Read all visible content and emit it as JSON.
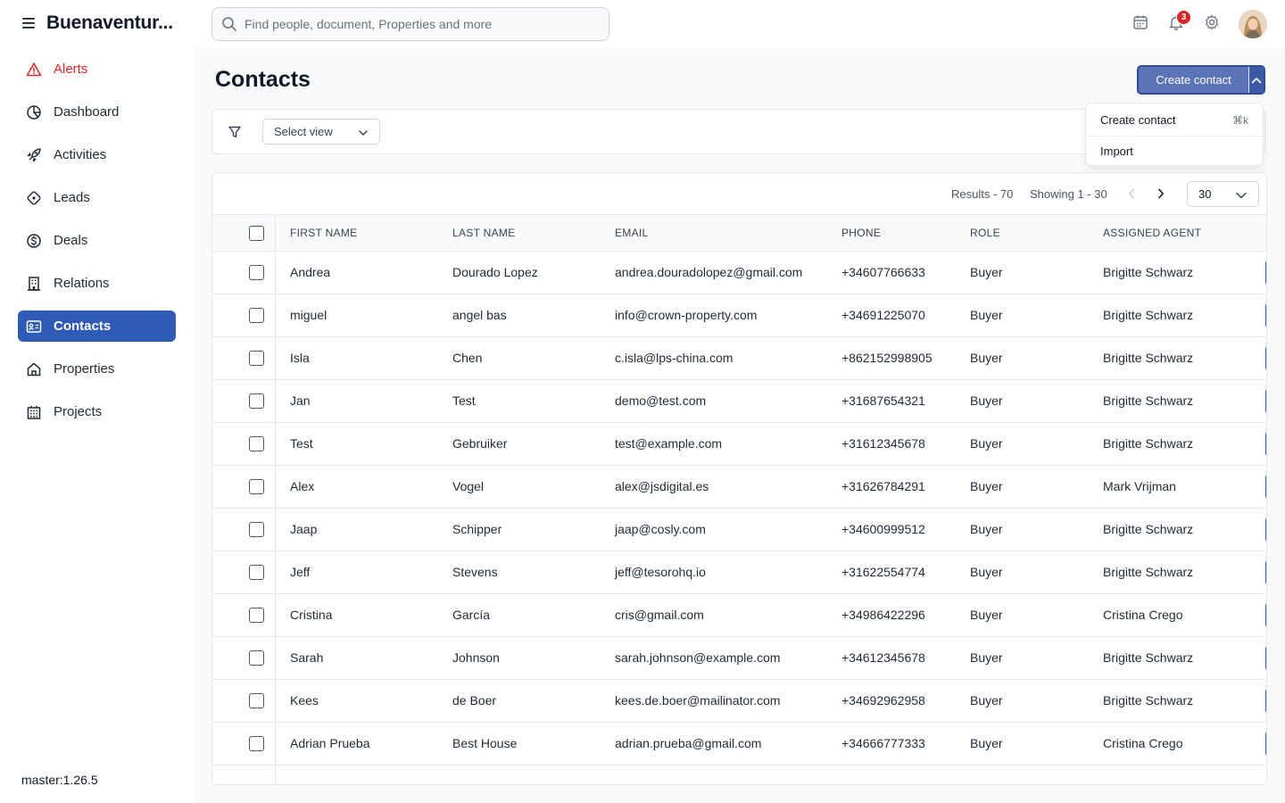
{
  "app": {
    "brand": "Buenaventur..."
  },
  "search": {
    "placeholder": "Find people, document, Properties and more"
  },
  "header": {
    "notification_count": "3"
  },
  "sidebar": {
    "items": [
      {
        "label": "Alerts",
        "icon": "alert-triangle-icon"
      },
      {
        "label": "Dashboard",
        "icon": "pie-chart-icon"
      },
      {
        "label": "Activities",
        "icon": "rocket-icon"
      },
      {
        "label": "Leads",
        "icon": "target-icon"
      },
      {
        "label": "Deals",
        "icon": "dollar-circle-icon"
      },
      {
        "label": "Relations",
        "icon": "building-icon"
      },
      {
        "label": "Contacts",
        "icon": "contact-card-icon"
      },
      {
        "label": "Properties",
        "icon": "home-icon"
      },
      {
        "label": "Projects",
        "icon": "apartment-icon"
      }
    ],
    "active": "Contacts",
    "version": "master:1.26.5"
  },
  "page": {
    "title": "Contacts"
  },
  "actions": {
    "create_label": "Create contact",
    "menu": [
      {
        "label": "Create contact",
        "shortcut": "⌘k"
      },
      {
        "label": "Import",
        "shortcut": ""
      }
    ]
  },
  "filters": {
    "select_view": "Select view"
  },
  "pagination": {
    "results": "Results - 70",
    "showing": "Showing 1 - 30",
    "per_page": "30"
  },
  "table": {
    "columns": [
      "FIRST NAME",
      "LAST NAME",
      "EMAIL",
      "PHONE",
      "ROLE",
      "ASSIGNED AGENT"
    ],
    "rows": [
      [
        "Andrea",
        "Dourado Lopez",
        "andrea.douradolopez@gmail.com",
        "+34607766633",
        "Buyer",
        "Brigitte Schwarz"
      ],
      [
        "miguel",
        "angel bas",
        "info@crown-property.com",
        "+34691225070",
        "Buyer",
        "Brigitte Schwarz"
      ],
      [
        "Isla",
        "Chen",
        "c.isla@lps-china.com",
        "+862152998905",
        "Buyer",
        "Brigitte Schwarz"
      ],
      [
        "Jan",
        "Test",
        "demo@test.com",
        "+31687654321",
        "Buyer",
        "Brigitte Schwarz"
      ],
      [
        "Test",
        "Gebruiker",
        "test@example.com",
        "+31612345678",
        "Buyer",
        "Brigitte Schwarz"
      ],
      [
        "Alex",
        "Vogel",
        "alex@jsdigital.es",
        "+31626784291",
        "Buyer",
        "Mark Vrijman"
      ],
      [
        "Jaap",
        "Schipper",
        "jaap@cosly.com",
        "+34600999512",
        "Buyer",
        "Brigitte Schwarz"
      ],
      [
        "Jeff",
        "Stevens",
        "jeff@tesorohq.io",
        "+31622554774",
        "Buyer",
        "Brigitte Schwarz"
      ],
      [
        "Cristina",
        "García",
        "cris@gmail.com",
        "+34986422296",
        "Buyer",
        "Cristina Crego"
      ],
      [
        "Sarah",
        "Johnson",
        "sarah.johnson@example.com",
        "+34612345678",
        "Buyer",
        "Brigitte Schwarz"
      ],
      [
        "Kees",
        "de Boer",
        "kees.de.boer@mailinator.com",
        "+34692962958",
        "Buyer",
        "Brigitte Schwarz"
      ],
      [
        "Adrian Prueba",
        "Best House",
        "adrian.prueba@gmail.com",
        "+34666777333",
        "Buyer",
        "Cristina Crego"
      ]
    ]
  },
  "colors": {
    "accent": "#2f5bb7",
    "alert": "#dc2626",
    "badge": "#dc2626"
  }
}
